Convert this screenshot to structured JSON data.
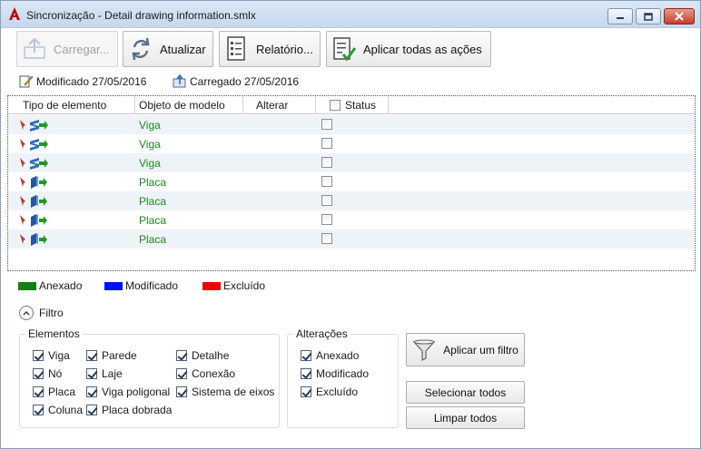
{
  "window": {
    "title": "Sincronização - Detail drawing information.smlx",
    "accent": "#c00000"
  },
  "toolbar": {
    "load_label": "Carregar...",
    "refresh_label": "Atualizar",
    "report_label": "Relatório...",
    "apply_all_label": "Aplicar todas as ações"
  },
  "meta": {
    "modified": "Modificado 27/05/2016",
    "loaded": "Carregado 27/05/2016"
  },
  "grid": {
    "columns": [
      "Tipo de elemento",
      "Objeto de modelo",
      "Alterar",
      "Status"
    ],
    "rows": [
      {
        "type_icon": "beam-icon",
        "object": "Viga",
        "status_checked": false
      },
      {
        "type_icon": "beam-icon",
        "object": "Viga",
        "status_checked": false
      },
      {
        "type_icon": "beam-icon",
        "object": "Viga",
        "status_checked": false
      },
      {
        "type_icon": "plate-icon",
        "object": "Placa",
        "status_checked": false
      },
      {
        "type_icon": "plate-icon",
        "object": "Placa",
        "status_checked": false
      },
      {
        "type_icon": "plate-icon",
        "object": "Placa",
        "status_checked": false
      },
      {
        "type_icon": "plate-icon",
        "object": "Placa",
        "status_checked": false
      }
    ]
  },
  "legend": {
    "attached": {
      "label": "Anexado",
      "color": "#108010"
    },
    "modified": {
      "label": "Modificado",
      "color": "#0010f0"
    },
    "deleted": {
      "label": "Excluído",
      "color": "#f00000"
    }
  },
  "filter": {
    "toggle_label": "Filtro",
    "elements": {
      "title": "Elementos",
      "items": [
        "Viga",
        "Nó",
        "Placa",
        "Coluna",
        "Parede",
        "Laje",
        "Viga poligonal",
        "Placa dobrada",
        "Detalhe",
        "Conexão",
        "Sistema de eixos"
      ]
    },
    "changes": {
      "title": "Alterações",
      "items": [
        "Anexado",
        "Modificado",
        "Excluído"
      ]
    },
    "apply_label": "Aplicar um filtro",
    "select_all_label": "Selecionar todos",
    "clear_all_label": "Limpar todos"
  }
}
